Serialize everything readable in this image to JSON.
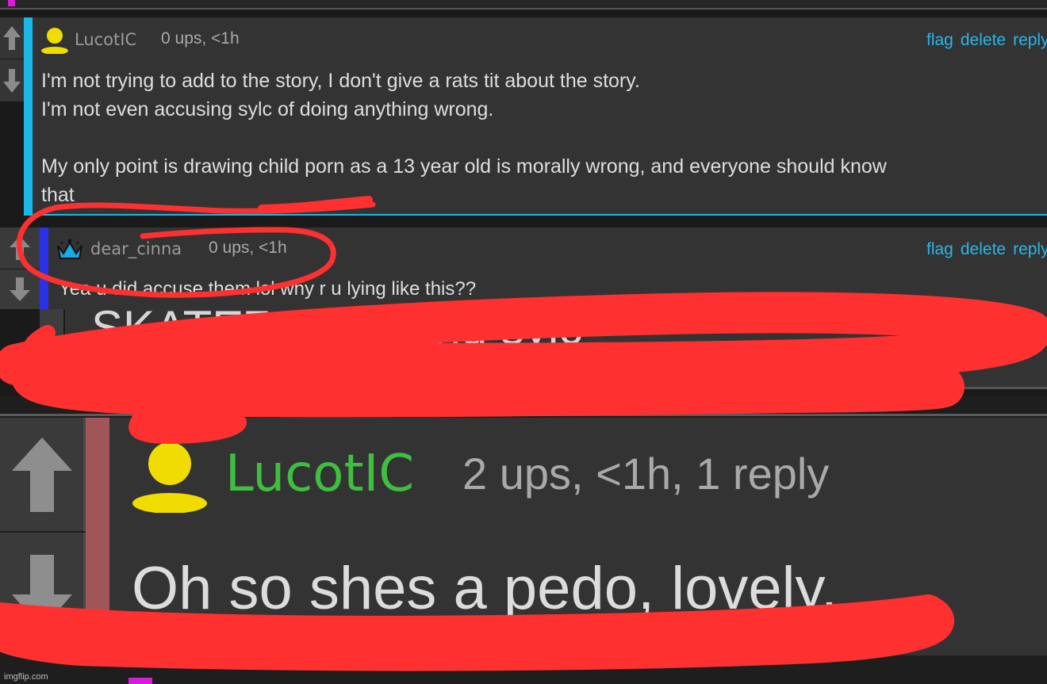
{
  "comments": [
    {
      "username": "LucotIC",
      "meta": "0 ups, <1h",
      "actions": [
        "flag",
        "delete",
        "reply"
      ],
      "lines": [
        "I'm not trying to add to the story, I don't give a rats tit about the story.",
        "I'm not even accusing sylc of doing anything wrong.",
        "",
        "My only point is drawing child porn as a 13 year old is morally wrong, and everyone should know",
        "that"
      ]
    },
    {
      "username": "dear_cinna",
      "meta": "0 ups, <1h",
      "actions": [
        "flag",
        "delete",
        "reply"
      ],
      "lines": [
        "Yea u did accuse them lol why r u lying like this??"
      ]
    }
  ],
  "partial_text": "SKATE7 IS 14 and sylc",
  "zoomed_comment": {
    "username": "LucotIC",
    "meta": "2 ups, <1h, 1 reply",
    "text": "Oh so shes a pedo, lovely."
  },
  "watermark": "imgflip.com",
  "colors": {
    "accent_cyan": "#19b8e8",
    "accent_blue": "#2a32e8",
    "accent_red": "#a05656",
    "username_green": "#3fbf3f",
    "link": "#29b6e8",
    "scribble": "#ff3030"
  }
}
